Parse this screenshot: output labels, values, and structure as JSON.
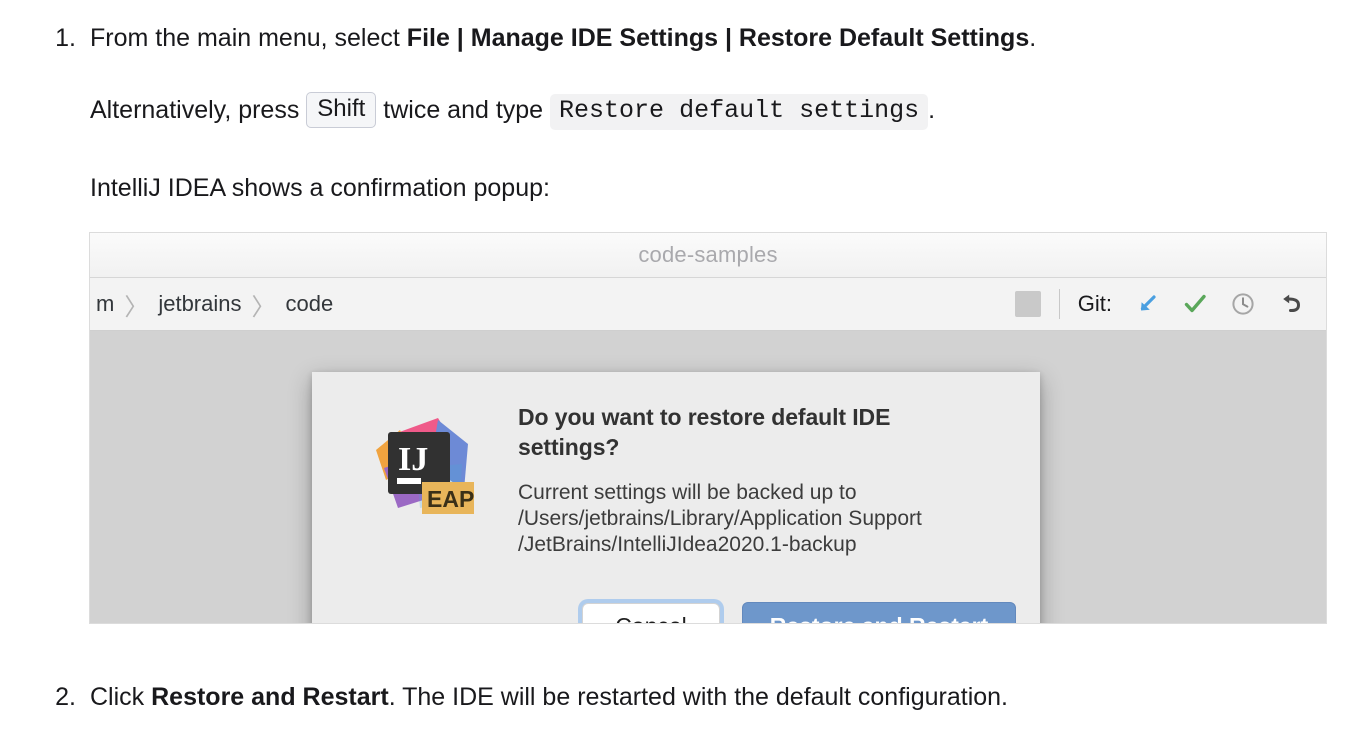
{
  "steps": [
    {
      "number": "1.",
      "text_before": "From the main menu, select ",
      "menu_path": "File | Manage IDE Settings | Restore Default Settings",
      "text_after": "."
    },
    {
      "number": "2.",
      "text_before": "Click ",
      "button_name": "Restore and Restart",
      "text_after": ". The IDE will be restarted with the default configuration."
    }
  ],
  "alternative": {
    "prefix": "Alternatively, press ",
    "key": "Shift",
    "middle": " twice and type ",
    "command": "Restore default settings",
    "suffix": "."
  },
  "caption": "IntelliJ IDEA shows a confirmation popup:",
  "screenshot": {
    "window_title": "code-samples",
    "breadcrumbs": [
      {
        "label": "m"
      },
      {
        "label": "jetbrains"
      },
      {
        "label": "code"
      }
    ],
    "breadcrumb_separator": "〉",
    "toolbar": {
      "git_label": "Git:",
      "icons": [
        {
          "name": "update-project-icon",
          "title": "Update Project",
          "color": "#4a9fe0"
        },
        {
          "name": "commit-icon",
          "title": "Commit",
          "color": "#5aa75a"
        },
        {
          "name": "history-icon",
          "title": "Show History",
          "color": "#9b9b9b"
        },
        {
          "name": "rollback-icon",
          "title": "Rollback",
          "color": "#4a4a4a"
        }
      ]
    },
    "dialog": {
      "logo_text": "IJ",
      "logo_badge": "EAP",
      "heading": "Do you want to restore default IDE settings?",
      "description_lines": [
        "Current settings will be backed up to",
        "/Users/jetbrains/Library/Application Support",
        "/JetBrains/IntelliJIdea2020.1-backup"
      ],
      "cancel_label": "Cancel",
      "confirm_label": "Restore and Restart"
    }
  },
  "colors": {
    "primary_button": "#6e97cb",
    "focus_ring": "#7eb2ee",
    "editor_background": "#d2d2d2",
    "dialog_background": "#ececec",
    "code_background": "#f2f2f3",
    "logo_pink": "#ef5a89",
    "logo_blue": "#6d8ad6",
    "logo_orange": "#f0a33f",
    "logo_purple": "#9b69c4",
    "logo_badge": "#e8b55a"
  }
}
